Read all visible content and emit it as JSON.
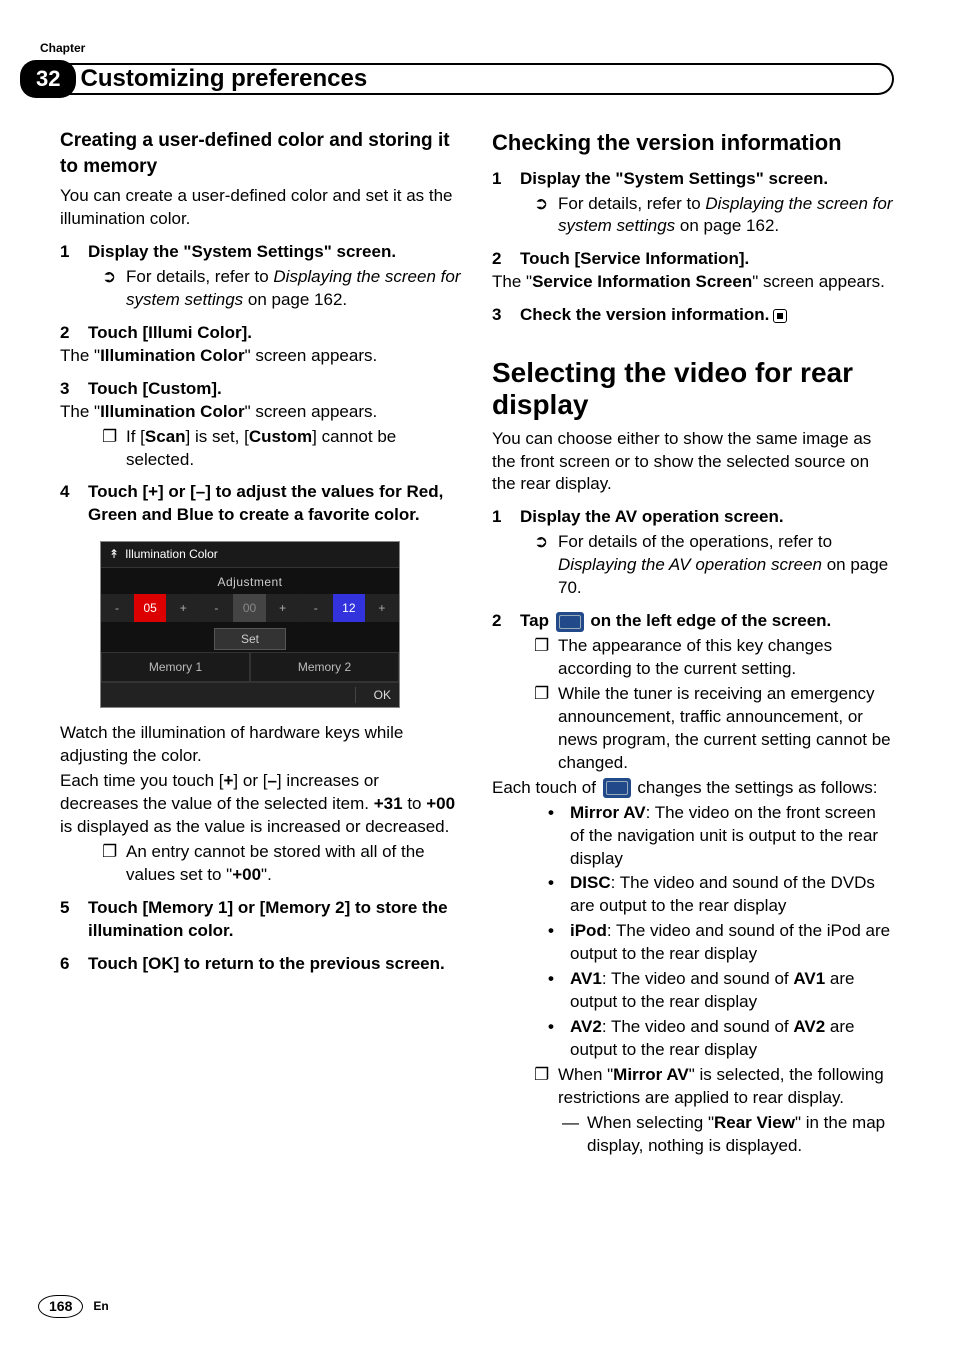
{
  "header": {
    "chapter_label": "Chapter",
    "chapter_number": "32",
    "chapter_title": "Customizing preferences"
  },
  "left": {
    "h_sub": "Creating a user-defined color and storing it to memory",
    "intro": "You can create a user-defined color and set it as the illumination color.",
    "s1": {
      "num": "1",
      "text": "Display the \"System Settings\" screen."
    },
    "s1_detail_pre": "For details, refer to ",
    "s1_detail_em": "Displaying the screen for system settings",
    "s1_detail_post": " on page 162.",
    "s2": {
      "num": "2",
      "text": "Touch [Illumi Color]."
    },
    "s2_tail_pre": "The \"",
    "s2_tail_bold": "Illumination Color",
    "s2_tail_post": "\" screen appears.",
    "s3": {
      "num": "3",
      "text": "Touch [Custom]."
    },
    "s3_tail_pre": "The \"",
    "s3_tail_bold": "Illumination Color",
    "s3_tail_post": "\" screen appears.",
    "s3_note_pre": "If [",
    "s3_note_b1": "Scan",
    "s3_note_mid": "] is set, [",
    "s3_note_b2": "Custom",
    "s3_note_post": "] cannot be selected.",
    "s4": {
      "num": "4",
      "text": "Touch [+] or [–] to adjust the values for Red, Green and Blue to create a favorite color."
    },
    "screenshot": {
      "title": "Illumination Color",
      "adjustment": "Adjustment",
      "minus": "-",
      "plus": "+",
      "r": "05",
      "g": "00",
      "b": "12",
      "set": "Set",
      "mem1": "Memory 1",
      "mem2": "Memory 2",
      "ok": "OK"
    },
    "post1": "Watch the illumination of hardware keys while adjusting the color.",
    "post2_pre": "Each time you touch [",
    "post2_b1": "+",
    "post2_mid1": "] or [",
    "post2_b2": "–",
    "post2_mid2": "] increases or decreases the value of the selected item. ",
    "post2_b3": "+31",
    "post2_mid3": " to ",
    "post2_b4": "+00",
    "post2_post": " is displayed as the value is increased or decreased.",
    "post2_note_pre": "An entry cannot be stored with all of the values set to \"",
    "post2_note_b": "+00",
    "post2_note_post": "\".",
    "s5": {
      "num": "5",
      "text": "Touch [Memory 1] or [Memory 2] to store the illumination color."
    },
    "s6": {
      "num": "6",
      "text": "Touch [OK] to return to the previous screen."
    }
  },
  "right": {
    "h_section": "Checking the version information",
    "s1": {
      "num": "1",
      "text": "Display the \"System Settings\" screen."
    },
    "s1_detail_pre": "For details, refer to ",
    "s1_detail_em": "Displaying the screen for system settings",
    "s1_detail_post": " on page 162.",
    "s2": {
      "num": "2",
      "text": "Touch [Service Information]."
    },
    "s2_tail_pre": "The \"",
    "s2_tail_bold": "Service Information Screen",
    "s2_tail_post": "\" screen appears.",
    "s3": {
      "num": "3",
      "text": "Check the version information."
    },
    "h_big": "Selecting the video for rear display",
    "big_intro": "You can choose either to show the same image as the front screen or to show the selected source on the rear display.",
    "b1": {
      "num": "1",
      "text": "Display the AV operation screen."
    },
    "b1_detail_pre": "For details of the operations, refer to ",
    "b1_detail_em": "Displaying the AV operation screen",
    "b1_detail_post": " on page 70.",
    "b2": {
      "num": "2",
      "pre": "Tap ",
      "post": " on the left edge of the screen."
    },
    "b2_note1": "The appearance of this key changes according to the current setting.",
    "b2_note2": "While the tuner is receiving an emergency announcement, traffic announcement, or news program, the current setting cannot be changed.",
    "b2_tail_pre": "Each touch of ",
    "b2_tail_post": " changes the settings as follows:",
    "opts": {
      "o1_b": "Mirror AV",
      "o1_t": ": The video on the front screen of the navigation unit is output to the rear display",
      "o2_b": "DISC",
      "o2_t": ": The video and sound of the DVDs are output to the rear display",
      "o3_b": "iPod",
      "o3_t": ": The video and sound of the iPod are output to the rear display",
      "o4_b": "AV1",
      "o4_t_pre": ": The video and sound of ",
      "o4_t_b": "AV1",
      "o4_t_post": " are output to the rear display",
      "o5_b": "AV2",
      "o5_t_pre": ": The video and sound of ",
      "o5_t_b": "AV2",
      "o5_t_post": " are output to the rear display"
    },
    "note_pre": "When \"",
    "note_b": "Mirror AV",
    "note_post": "\" is selected, the following restrictions are applied to rear display.",
    "note_sub_pre": "When selecting \"",
    "note_sub_b": "Rear View",
    "note_sub_post": "\" in the map display, nothing is displayed."
  },
  "footer": {
    "page": "168",
    "lang": "En"
  }
}
